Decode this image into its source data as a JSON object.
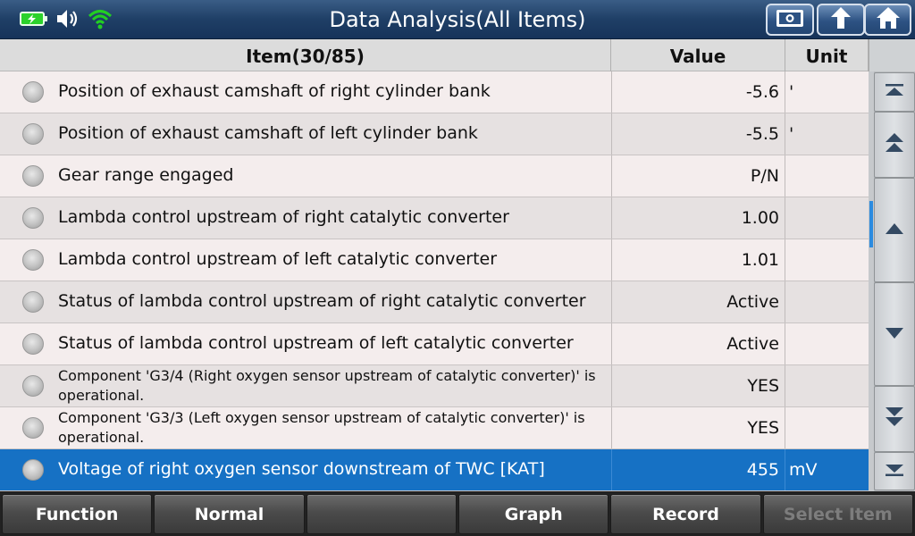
{
  "window": {
    "title": "Data Analysis(All Items)"
  },
  "status": {
    "battery_icon": "battery-charging-icon",
    "volume_icon": "volume-icon",
    "wifi_icon": "wifi-icon",
    "wifi_color": "#22d022",
    "battery_color": "#2bd12b"
  },
  "toolbar": {
    "buttons": [
      "screenshot-icon",
      "back-arrow-icon",
      "home-icon"
    ]
  },
  "table": {
    "headers": {
      "item": "Item(30/85)",
      "value": "Value",
      "unit": "Unit"
    },
    "rows": [
      {
        "item": "Position of exhaust camshaft of right cylinder bank",
        "value": "-5.6",
        "unit": "'"
      },
      {
        "item": "Position of exhaust camshaft of left cylinder bank",
        "value": "-5.5",
        "unit": "'"
      },
      {
        "item": "Gear range engaged",
        "value": "P/N",
        "unit": ""
      },
      {
        "item": "Lambda control upstream of right catalytic converter",
        "value": "1.00",
        "unit": ""
      },
      {
        "item": "Lambda control upstream of left catalytic converter",
        "value": "1.01",
        "unit": ""
      },
      {
        "item": "Status of lambda control upstream of right catalytic converter",
        "value": "Active",
        "unit": ""
      },
      {
        "item": "Status of lambda control upstream of left catalytic converter",
        "value": "Active",
        "unit": ""
      },
      {
        "item": "Component 'G3/4 (Right oxygen sensor upstream of catalytic converter)' is operational.",
        "value": "YES",
        "unit": ""
      },
      {
        "item": "Component 'G3/3 (Left oxygen sensor upstream of catalytic converter)' is operational.",
        "value": "YES",
        "unit": ""
      },
      {
        "item": "Voltage of right oxygen sensor downstream of TWC [KAT]",
        "value": "455",
        "unit": "mV"
      }
    ],
    "selected_index": 9,
    "selected_color": "#1671c4"
  },
  "scrollbar": {
    "buttons": [
      "scroll-to-top-icon",
      "page-up-icon",
      "line-up-icon",
      "line-down-icon",
      "page-down-icon",
      "scroll-to-bottom-icon"
    ],
    "thumb_color": "#2b8be0"
  },
  "bottom": {
    "buttons": [
      {
        "label": "Function",
        "enabled": true
      },
      {
        "label": "Normal",
        "enabled": true
      },
      {
        "label": "",
        "enabled": true
      },
      {
        "label": "Graph",
        "enabled": true
      },
      {
        "label": "Record",
        "enabled": true
      },
      {
        "label": "Select Item",
        "enabled": false
      }
    ]
  }
}
